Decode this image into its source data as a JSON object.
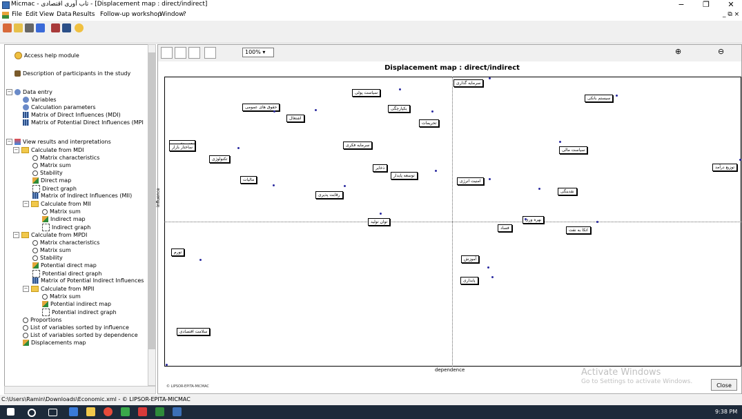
{
  "window": {
    "title": "Micmac - تاب آوری اقتصادی - [Displacement map : direct/indirect]",
    "minimize": "−",
    "maximize": "❐",
    "close": "✕"
  },
  "menu": [
    "File",
    "Edit",
    "View",
    "Data",
    "Results",
    "Follow-up workshop",
    "Window",
    "?"
  ],
  "menu_right": "_ ⧉ ×",
  "tree": {
    "access_help": "Access help module",
    "description": "Description of participants in the study",
    "data_entry": "Data entry",
    "variables": "Variables",
    "calc_params": "Calculation parameters",
    "mdi": "Matrix of Direct Influences (MDI)",
    "mpdi": "Matrix of Potential Direct Influences (MPI",
    "view_results": "View results and interpretations",
    "calc_mdi": "Calculate from MDI",
    "matrix_char": "Matrix characteristics",
    "matrix_sum": "Matrix sum",
    "stability": "Stability",
    "direct_map": "Direct map",
    "direct_graph": "Direct graph",
    "mii": "Matrix of Indirect Influences (MII)",
    "calc_mii": "Calculate from MII",
    "mii_sum": "Matrix sum",
    "indirect_map": "Indirect map",
    "indirect_graph": "Indirect graph",
    "calc_mpdi": "Calculate from MPDI",
    "mpdi_char": "Matrix characteristics",
    "mpdi_sum": "Matrix sum",
    "mpdi_stability": "Stability",
    "pot_direct_map": "Potential direct map",
    "pot_direct_graph": "Potential direct graph",
    "mpii": "Matrix of Potential Indirect Influences",
    "calc_mpii": "Calculate from MPII",
    "mpii_sum": "Matrix sum",
    "pot_indirect_map": "Potential indirect map",
    "pot_indirect_graph": "Potential indirect graph",
    "proportions": "Proportions",
    "sorted_influence": "List of variables sorted by influence",
    "sorted_dependence": "List of variables sorted by dependence",
    "displacements_map": "Displacements map"
  },
  "map": {
    "zoom": "100%",
    "title": "Displacement map :  direct/indirect",
    "xlabel": "dependence",
    "ylabel": "influence",
    "copyright": "© LIPSOR-EPITA-MICMAC",
    "variables": [
      "سرمایه گذاری",
      "سیاست پولی",
      "سیستم بانکی",
      "حقوق های عمومی",
      "یکپارچگی",
      "اشتغال",
      "تحریمات",
      "عدم تخصص",
      "سرمایه فکری",
      "سیاست مالی",
      "تکنولوژی",
      "توزیع درآمد",
      "توسعه پایدار",
      "امنیت انرژی",
      "مالیات",
      "نقدینگی",
      "رقابت پذیری",
      "توان تولید",
      "فساد",
      "اتکا به نفت",
      "تورم",
      "آموزش",
      "پایداری",
      "سلامت اقتصادی",
      "ساختار بازار",
      "ذخایر",
      "بهره وری"
    ]
  },
  "watermark": {
    "line1": "Activate Windows",
    "line2": "Go to Settings to activate Windows."
  },
  "close_button": "Close",
  "status": "C:\\Users\\Ramin\\Downloads\\Economic.xml - © LIPSOR-EPITA-MICMAC",
  "taskbar": {
    "clock": "9:38 PM"
  },
  "colors": {
    "accent": "#2a2aa0",
    "taskbar": "#1d2a3a"
  }
}
